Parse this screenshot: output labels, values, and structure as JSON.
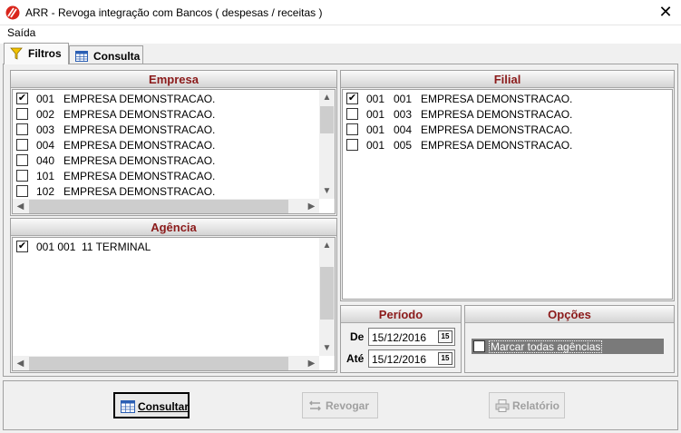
{
  "window": {
    "title": "ARR - Revoga integração com Bancos ( despesas / receitas )",
    "close_glyph": "✕"
  },
  "menu": {
    "items": [
      "Saída"
    ]
  },
  "tabs": [
    {
      "label": "Filtros",
      "icon": "filter-icon",
      "active": true
    },
    {
      "label": "Consulta",
      "icon": "table-icon",
      "active": false
    }
  ],
  "empresa": {
    "title": "Empresa",
    "rows": [
      {
        "checked": true,
        "code": "001",
        "name": "EMPRESA DEMONSTRACAO."
      },
      {
        "checked": false,
        "code": "002",
        "name": "EMPRESA DEMONSTRACAO."
      },
      {
        "checked": false,
        "code": "003",
        "name": "EMPRESA DEMONSTRACAO."
      },
      {
        "checked": false,
        "code": "004",
        "name": "EMPRESA DEMONSTRACAO."
      },
      {
        "checked": false,
        "code": "040",
        "name": "EMPRESA DEMONSTRACAO."
      },
      {
        "checked": false,
        "code": "101",
        "name": "EMPRESA DEMONSTRACAO."
      },
      {
        "checked": false,
        "code": "102",
        "name": "EMPRESA DEMONSTRACAO."
      }
    ]
  },
  "agencia": {
    "title": "Agência",
    "rows": [
      {
        "checked": true,
        "code": "001 001",
        "name": "11 TERMINAL"
      }
    ]
  },
  "filial": {
    "title": "Filial",
    "rows": [
      {
        "checked": true,
        "empresa": "001",
        "code": "001",
        "name": "EMPRESA DEMONSTRACAO."
      },
      {
        "checked": false,
        "empresa": "001",
        "code": "003",
        "name": "EMPRESA DEMONSTRACAO."
      },
      {
        "checked": false,
        "empresa": "001",
        "code": "004",
        "name": "EMPRESA DEMONSTRACAO."
      },
      {
        "checked": false,
        "empresa": "001",
        "code": "005",
        "name": "EMPRESA DEMONSTRACAO."
      }
    ]
  },
  "periodo": {
    "title": "Período",
    "de_label": "De",
    "de_value": "15/12/2016",
    "ate_label": "Até",
    "ate_value": "15/12/2016",
    "calendar_glyph": "15"
  },
  "opcoes": {
    "title": "Opções",
    "marcar_label": "Marcar todas agências",
    "marcar_checked": false
  },
  "buttons": {
    "consultar": {
      "label": "Consultar",
      "enabled": true
    },
    "revogar": {
      "label": "Revogar",
      "enabled": false
    },
    "relatorio": {
      "label": "Relatório",
      "enabled": false
    }
  },
  "scroll_glyphs": {
    "up": "▲",
    "down": "▼",
    "left": "◀",
    "right": "▶"
  },
  "check_glyph": "✔",
  "colors": {
    "group_title": "#8b1a1a",
    "logo": "#d9261c"
  }
}
